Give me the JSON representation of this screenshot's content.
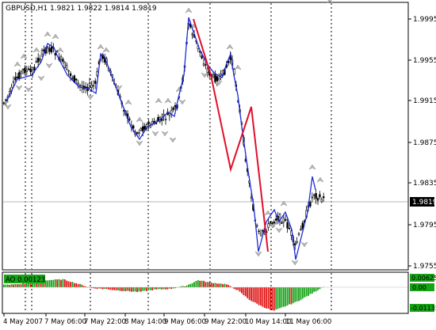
{
  "window": {
    "title": "GBPUSD,H1  1.9821 1.9822 1.9814 1.9819"
  },
  "main_chart": {
    "price_labels": [
      "1.9995",
      "1.9955",
      "1.9915",
      "1.9875",
      "1.9835",
      "1.9795",
      "1.9755"
    ],
    "current_price": "1.9819",
    "colors": {
      "bull_candle": "#000000",
      "bear_candle": "#000000",
      "blue_line": "#1f2bd6",
      "red_line": "#e0102a",
      "fractal_arrow": "#b0b0b0",
      "grid": "#000000"
    }
  },
  "indicator": {
    "label": "AO 0.00123",
    "levels": [
      "0.00625",
      "0.00",
      "-0.01135"
    ],
    "colors": {
      "up": "#16a316",
      "down": "#e01515"
    }
  },
  "time_axis": {
    "labels": [
      "4 May 2007",
      "7 May 06:00",
      "7 May 22:00",
      "8 May 14:00",
      "9 May 06:00",
      "9 May 22:00",
      "10 May 14:00",
      "11 May 06:00"
    ]
  }
}
